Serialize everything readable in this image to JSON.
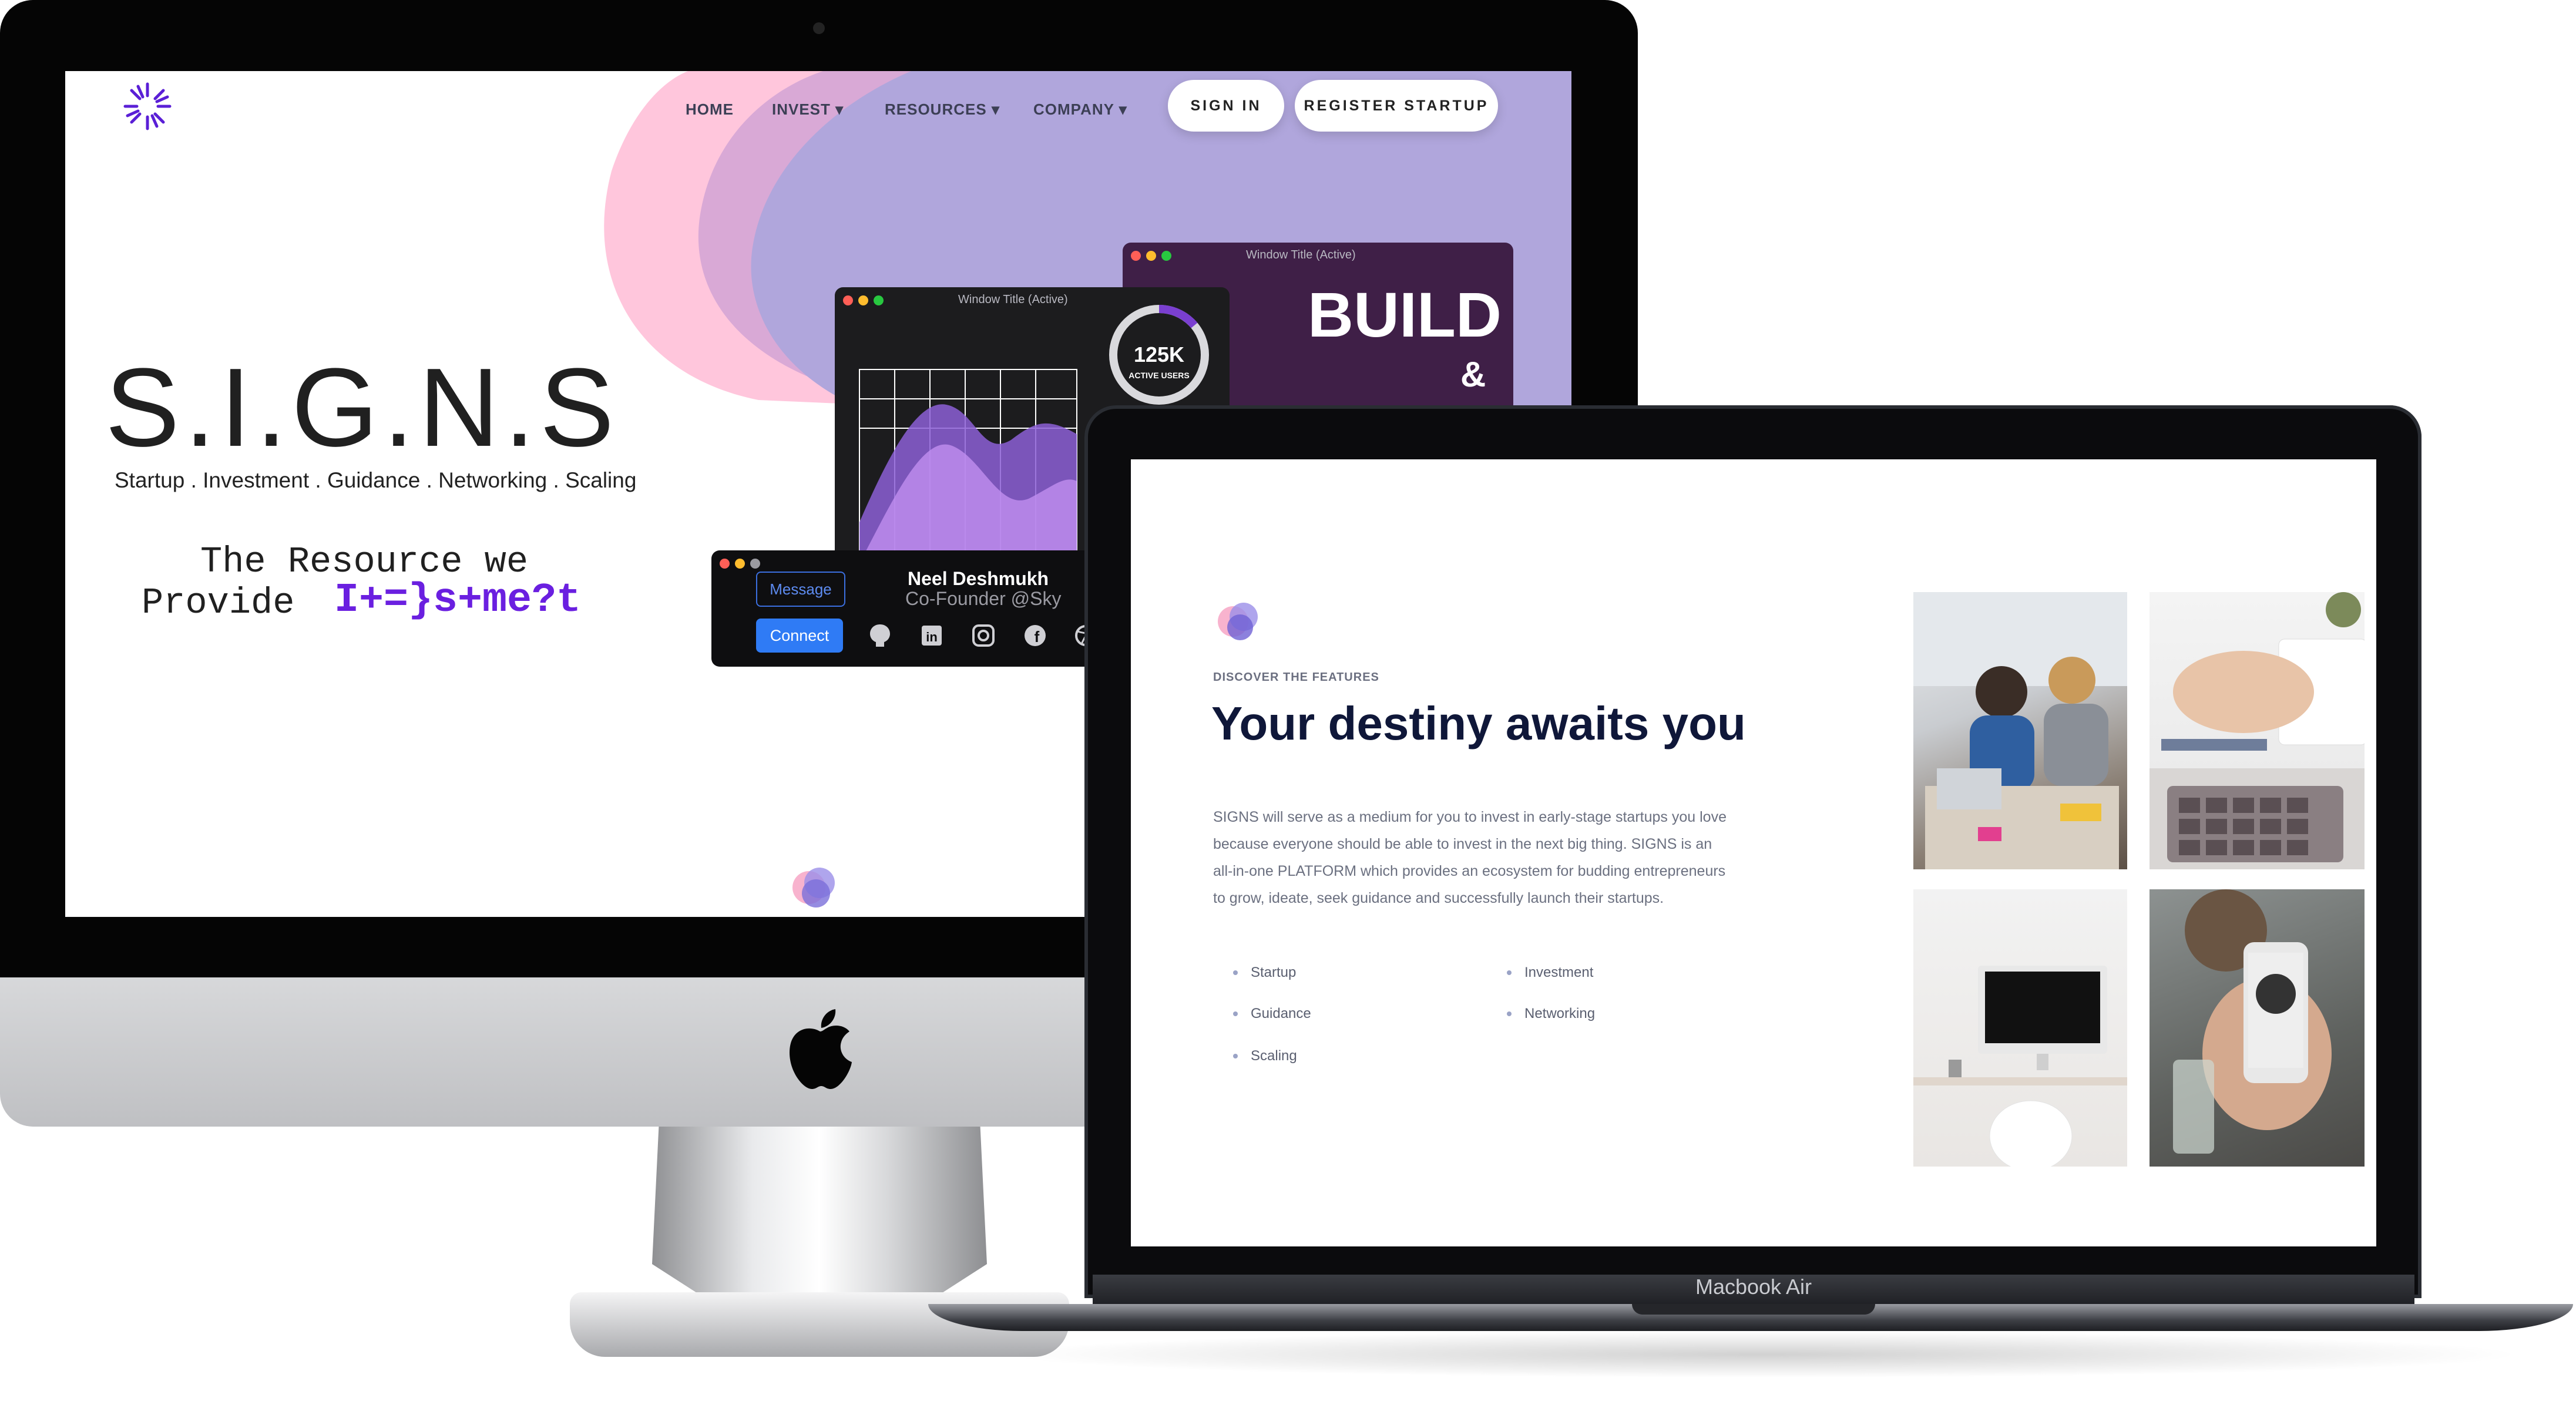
{
  "nav": {
    "home": "HOME",
    "invest": "INVEST",
    "resources": "RESOURCES",
    "company": "COMPANY",
    "sign_in": "SIGN IN",
    "register": "REGISTER STARTUP"
  },
  "hero": {
    "title": "S.I.G.N.S",
    "subtitle": "Startup . Investment . Guidance . Networking . Scaling",
    "line1": "The Resource we",
    "line2_prefix": "Provide",
    "line2_highlight": "I+=}s+me?t"
  },
  "windows": {
    "build_title": "Window Title (Active)",
    "build_text": "BUILD",
    "amp_text": "&",
    "chart_title": "Window Title (Active)",
    "stat_value": "125K",
    "stat_label": "ACTIVE USERS",
    "profile_name": "Neel Deshmukh",
    "profile_role": "Co-Founder @Sky",
    "message_btn": "Message",
    "connect_btn": "Connect"
  },
  "features": {
    "eyebrow": "DISCOVER THE FEATURES",
    "title": "Your destiny awaits you",
    "description": "SIGNS will serve as a medium for you to invest in early-stage startups you love because everyone should be able to invest in the next big thing. SIGNS is an all-in-one PLATFORM which provides an ecosystem for budding entrepreneurs to grow, ideate, seek guidance and successfully launch their startups.",
    "items": [
      "Startup",
      "Investment",
      "Guidance",
      "Networking",
      "Scaling"
    ]
  },
  "device": {
    "laptop_label": "Macbook Air"
  },
  "colors": {
    "accent_purple": "#6a1fe0",
    "blob_pink": "#ffc6dc",
    "blob_lavender": "#b0a6dc",
    "title_navy": "#0f1739",
    "connect_blue": "#2f7bf5"
  },
  "icons": [
    "star-logo-icon",
    "apple-logo-icon",
    "github-icon",
    "linkedin-icon",
    "instagram-icon",
    "facebook-icon",
    "dribbble-icon",
    "blob-logo-icon"
  ]
}
